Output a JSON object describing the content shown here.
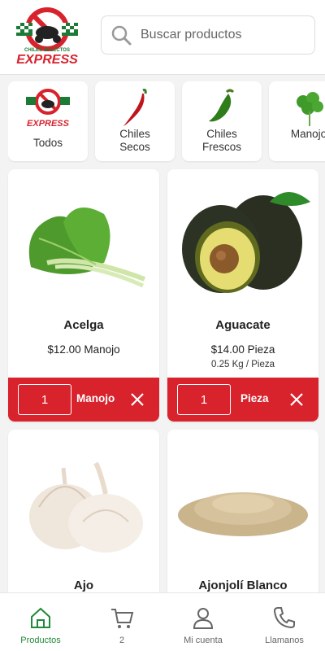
{
  "header": {
    "logo": {
      "top_text": "CHILES SELECTOS",
      "main_text": "EXPRESS"
    },
    "search": {
      "placeholder": "Buscar productos",
      "icon": "search-icon"
    }
  },
  "categories": [
    {
      "label": "Todos",
      "icon": "logo"
    },
    {
      "label": "Chiles\nSecos",
      "icon": "red-chile-icon"
    },
    {
      "label": "Chiles\nFrescos",
      "icon": "green-chile-icon"
    },
    {
      "label": "Manojo",
      "icon": "herb-icon"
    }
  ],
  "products": [
    {
      "name": "Acelga",
      "price": "$12.00 Manojo",
      "subtitle": "",
      "quantity": "1",
      "unit": "Manojo",
      "image": "chard-icon"
    },
    {
      "name": "Aguacate",
      "price": "$14.00 Pieza",
      "subtitle": "0.25 Kg / Pieza",
      "quantity": "1",
      "unit": "Pieza",
      "image": "avocado-icon"
    },
    {
      "name": "Ajo",
      "price": "",
      "subtitle": "",
      "quantity": "",
      "unit": "",
      "image": "garlic-icon"
    },
    {
      "name": "Ajonjolí Blanco",
      "price": "",
      "subtitle": "",
      "quantity": "",
      "unit": "",
      "image": "sesame-icon"
    }
  ],
  "nav": [
    {
      "label": "Productos",
      "icon": "home-icon",
      "active": true
    },
    {
      "label": "2",
      "icon": "cart-icon",
      "active": false
    },
    {
      "label": "Mi cuenta",
      "icon": "user-icon",
      "active": false
    },
    {
      "label": "Llamanos",
      "icon": "phone-icon",
      "active": false
    }
  ],
  "colors": {
    "accent_red": "#d8222c",
    "active_green": "#20893a"
  }
}
